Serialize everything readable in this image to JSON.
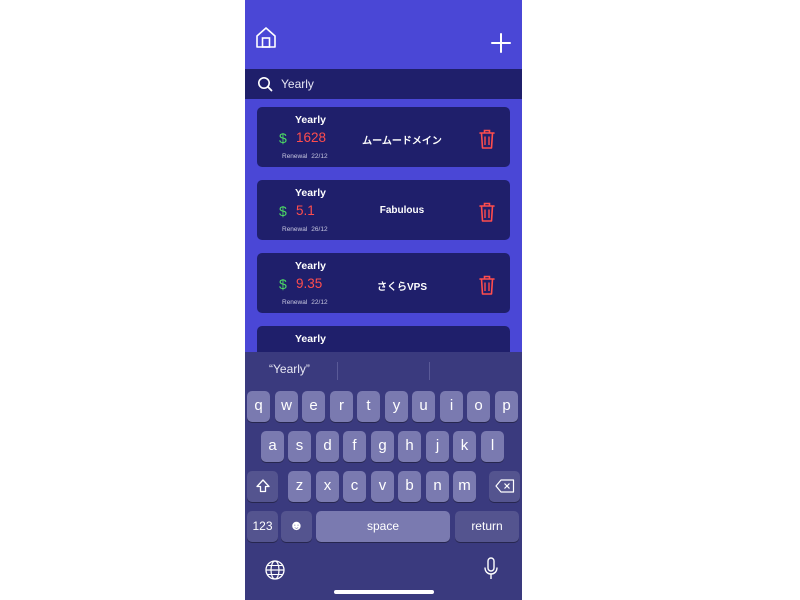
{
  "colors": {
    "app_bg": "#4a47d6",
    "card_bg": "#1f1f6b",
    "amount": "#ff4d4d",
    "dollar": "#4cd964",
    "keyboard_bg": "#3a3a7e",
    "key_bg": "#7a7ab0",
    "key_func_bg": "#54548f"
  },
  "header": {
    "home_icon": "home-icon",
    "add_icon": "plus-icon"
  },
  "search": {
    "icon": "search-icon",
    "value": "Yearly"
  },
  "subscriptions": [
    {
      "period": "Yearly",
      "currency": "$",
      "amount": "1628",
      "renewal_label": "Renewal",
      "renewal_date": "22/12",
      "name": "ムームードメイン"
    },
    {
      "period": "Yearly",
      "currency": "$",
      "amount": "5.1",
      "renewal_label": "Renewal",
      "renewal_date": "26/12",
      "name": "Fabulous"
    },
    {
      "period": "Yearly",
      "currency": "$",
      "amount": "9.35",
      "renewal_label": "Renewal",
      "renewal_date": "22/12",
      "name": "さくらVPS"
    },
    {
      "period": "Yearly",
      "currency": "$",
      "amount": "",
      "renewal_label": "",
      "renewal_date": "",
      "name": ""
    }
  ],
  "keyboard": {
    "suggestion": "“Yearly”",
    "row1": [
      "q",
      "w",
      "e",
      "r",
      "t",
      "y",
      "u",
      "i",
      "o",
      "p"
    ],
    "row2": [
      "a",
      "s",
      "d",
      "f",
      "g",
      "h",
      "j",
      "k",
      "l"
    ],
    "row3": [
      "z",
      "x",
      "c",
      "v",
      "b",
      "n",
      "m"
    ],
    "numbers_label": "123",
    "space_label": "space",
    "return_label": "return",
    "emoji_glyph": "☻"
  }
}
